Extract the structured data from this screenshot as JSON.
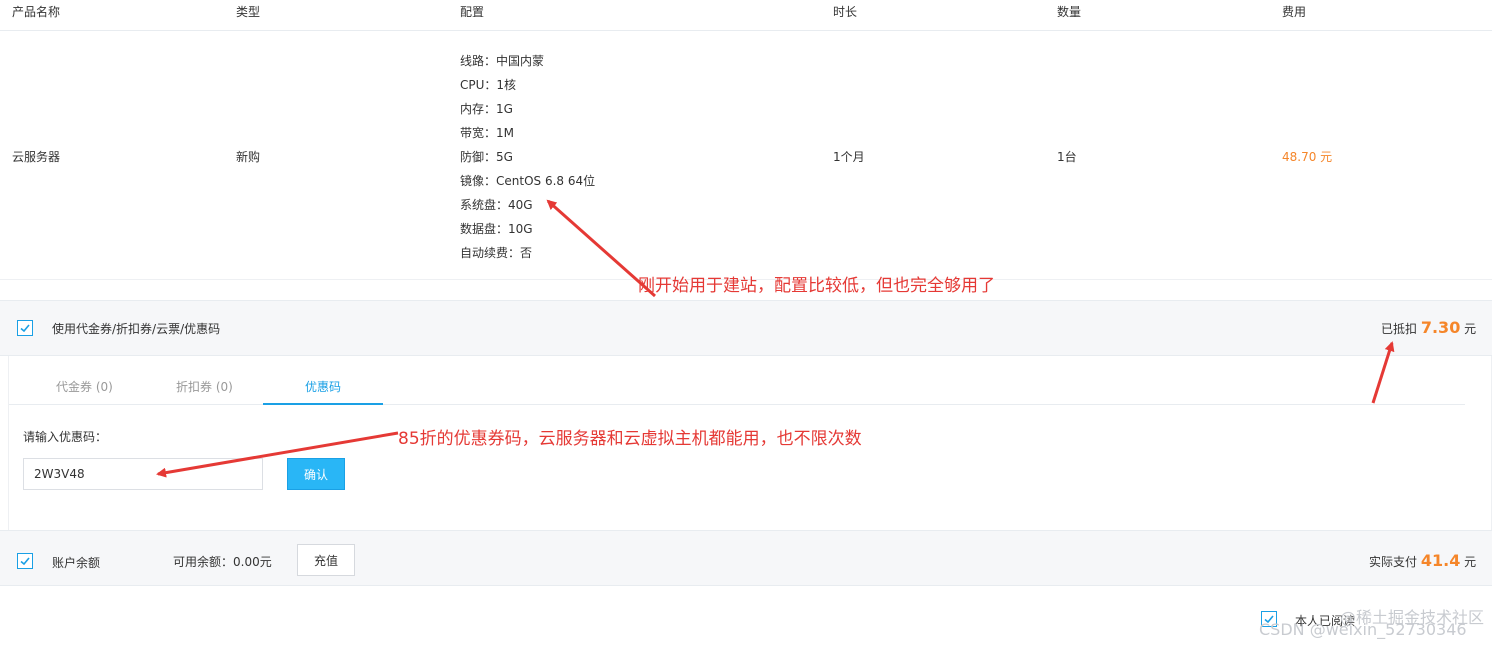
{
  "table": {
    "headers": [
      "产品名称",
      "类型",
      "配置",
      "时长",
      "数量",
      "费用"
    ],
    "row": {
      "name": "云服务器",
      "type": "新购",
      "config": [
        "线路：中国内蒙",
        "CPU：1核",
        "内存：1G",
        "带宽：1M",
        "防御：5G",
        "镜像：CentOS 6.8 64位",
        "系统盘：40G",
        "数据盘：10G",
        "自动续费：否"
      ],
      "duration": "1个月",
      "quantity": "1台",
      "price": "48.70 元"
    }
  },
  "coupon": {
    "label": "使用代金券/折扣券/云票/优惠码",
    "checked": true,
    "deducted_label": "已抵扣",
    "deducted_value": "7.30",
    "deducted_unit": "元"
  },
  "tabs": [
    {
      "label": "代金券 (0)",
      "active": false
    },
    {
      "label": "折扣券 (0)",
      "active": false
    },
    {
      "label": "优惠码",
      "active": true
    }
  ],
  "promo": {
    "prompt": "请输入优惠码：",
    "value": "2W3V48",
    "confirm_label": "确认"
  },
  "balance": {
    "label": "账户余额",
    "checked": true,
    "available": "可用余额：0.00元",
    "recharge_label": "充值",
    "pay_label": "实际支付",
    "pay_value": "41.4",
    "pay_unit": "元"
  },
  "agreement": {
    "label": "本人已阅读",
    "checked": true
  },
  "annotations": {
    "note1": "刚开始用于建站，配置比较低，但也完全够用了",
    "note2": "85折的优惠券码，云服务器和云虚拟主机都能用，也不限次数"
  },
  "watermark": {
    "line1": "@稀土掘金技术社区",
    "line2": "CSDN @weixin_52730346"
  },
  "colors": {
    "accent": "#1aa0e5",
    "price": "#f5862a",
    "annotation": "#e53935"
  }
}
